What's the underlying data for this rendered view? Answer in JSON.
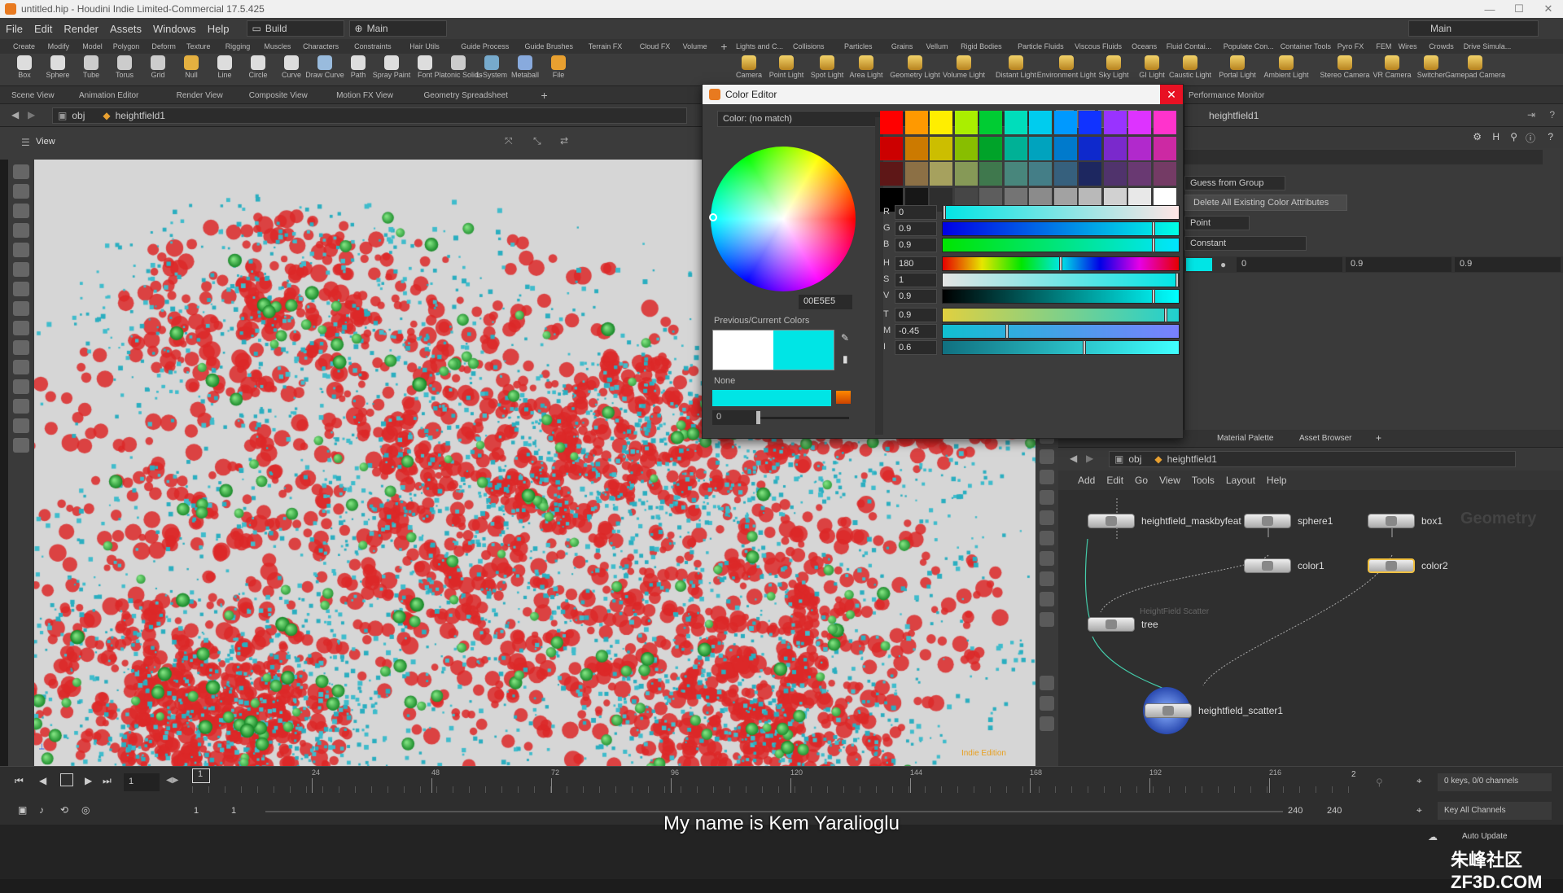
{
  "window": {
    "title": "untitled.hip - Houdini Indie Limited-Commercial 17.5.425"
  },
  "menu": [
    "File",
    "Edit",
    "Render",
    "Assets",
    "Windows",
    "Help"
  ],
  "desktop_combo": "Build",
  "main_combo": "Main",
  "main_combo_right": "Main",
  "shelf_tabs_left": [
    "Create",
    "Modify",
    "Model",
    "Polygon",
    "Deform",
    "Texture",
    "Rigging",
    "Muscles",
    "Characters",
    "Constraints",
    "Hair Utils",
    "Guide Process",
    "Guide Brushes",
    "Terrain FX",
    "Cloud FX",
    "Volume"
  ],
  "shelf_tabs_right": [
    "Lights and C...",
    "Collisions",
    "Particles",
    "Grains",
    "Vellum",
    "Rigid Bodies",
    "Particle Fluids",
    "Viscous Fluids",
    "Oceans",
    "Fluid Contai...",
    "Populate Con...",
    "Container Tools",
    "Pyro FX",
    "FEM",
    "Wires",
    "Crowds",
    "Drive Simula..."
  ],
  "tools_left": [
    "Box",
    "Sphere",
    "Tube",
    "Torus",
    "Grid",
    "Null",
    "Line",
    "Circle",
    "Curve",
    "Draw Curve",
    "Path",
    "Spray Paint",
    "Font",
    "Platonic Solids",
    "L-System",
    "Metaball",
    "File"
  ],
  "tools_right": [
    "Camera",
    "Point Light",
    "Spot Light",
    "Area Light",
    "Geometry Light",
    "Volume Light",
    "Distant Light",
    "Environment Light",
    "Sky Light",
    "GI Light",
    "Caustic Light",
    "Portal Light",
    "Ambient Light",
    "Stereo Camera",
    "VR Camera",
    "Switcher",
    "Gamepad Camera"
  ],
  "pane_tabs": [
    "Scene View",
    "Animation Editor",
    "Render View",
    "Composite View",
    "Motion FX View",
    "Geometry Spreadsheet"
  ],
  "pane_tab_right": "Performance Monitor",
  "path": {
    "root": "obj",
    "node": "heightfield1"
  },
  "viewport": {
    "label": "View",
    "watermark": "Indie Edition"
  },
  "color_editor": {
    "title": "Color Editor",
    "match": "Color: (no match)",
    "hex": "00E5E5",
    "previous_label": "Previous/Current Colors",
    "none_label": "None",
    "none_value": "0",
    "channels": [
      {
        "key": "R",
        "value": "0"
      },
      {
        "key": "G",
        "value": "0.9"
      },
      {
        "key": "B",
        "value": "0.9"
      },
      {
        "key": "H",
        "value": "180"
      },
      {
        "key": "S",
        "value": "1"
      },
      {
        "key": "V",
        "value": "0.9"
      },
      {
        "key": "T",
        "value": "0.9"
      },
      {
        "key": "M",
        "value": "-0.45"
      },
      {
        "key": "I",
        "value": "0.6"
      }
    ],
    "current_color": "#00e5e5",
    "swatches": [
      "#ff0000",
      "#ff9900",
      "#ffee00",
      "#aaee00",
      "#00cc33",
      "#00ddbb",
      "#00ccee",
      "#0099ff",
      "#1133ff",
      "#9933ff",
      "#dd33ff",
      "#ff33cc"
    ]
  },
  "params": {
    "group_type": "Guess from Group",
    "delete_attrs": "Delete All Existing Color Attributes",
    "class": "Point",
    "color_type": "Constant",
    "color": [
      "0",
      "0.9",
      "0.9"
    ]
  },
  "net": {
    "tabs": [
      "Material Palette",
      "Asset Browser"
    ],
    "path_root": "obj",
    "path_node": "heightfield1",
    "menu": [
      "Add",
      "Edit",
      "Go",
      "View",
      "Tools",
      "Layout",
      "Help"
    ],
    "context": "Geometry",
    "nodes": {
      "maskbyfeature": "heightfield_maskbyfeat",
      "sphere": "sphere1",
      "box": "box1",
      "color1": "color1",
      "color2": "color2",
      "tree": "tree",
      "tree_sub": "HeightField Scatter",
      "scatter": "heightfield_scatter1"
    }
  },
  "timeline": {
    "frame": "1",
    "ticks": [
      "24",
      "48",
      "72",
      "96",
      "120",
      "144",
      "168",
      "192",
      "216"
    ],
    "start": "1",
    "start2": "1",
    "end": "240",
    "end2": "240",
    "keys": "0 keys, 0/0 channels",
    "key_all": "Key All Channels",
    "auto_update": "Auto Update"
  },
  "subtitle": "My name is Kem Yaralioglu",
  "watermark": "朱峰社区 ZF3D.COM"
}
